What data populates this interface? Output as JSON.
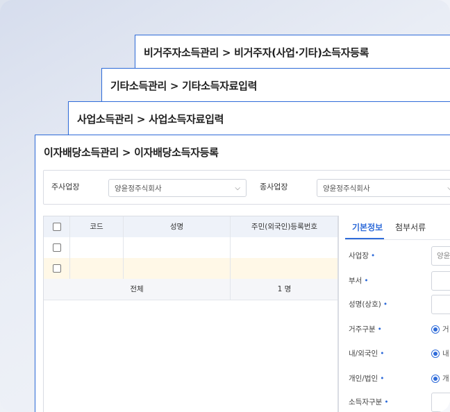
{
  "cards": {
    "card1_title": "비거주자소득관리 > 비거주자(사업·기타)소득자등록",
    "card2_title": "기타소득관리 > 기타소득자료입력",
    "card3_title": "사업소득관리 > 사업소득자료입력",
    "card4_title": "이자배당소득관리 > 이자배당소득자등록"
  },
  "filter": {
    "main_label": "주사업장",
    "main_value": "양윤정주식회사",
    "sub_label": "종사업장",
    "sub_value": "양윤정주식회사"
  },
  "grid": {
    "headers": [
      "코드",
      "성명",
      "주민(외국인)등록번호"
    ],
    "total_label": "전체",
    "total_count": "1 명"
  },
  "tabs": [
    "기본정보",
    "첨부서류"
  ],
  "form": {
    "workplace_label": "사업장",
    "workplace_value": "양윤",
    "dept_label": "부서",
    "name_label": "성명(상호)",
    "residence_label": "거주구분",
    "residence_value": "거",
    "nationality_label": "내/외국인",
    "nationality_value": "내",
    "person_type_label": "개인/법인",
    "person_type_value": "개",
    "income_type_label": "소득자구분",
    "required_mark": "•"
  },
  "colors": {
    "accent": "#2e6bd9",
    "selected_row": "#fff8e7",
    "header_row": "#eef2f9"
  }
}
